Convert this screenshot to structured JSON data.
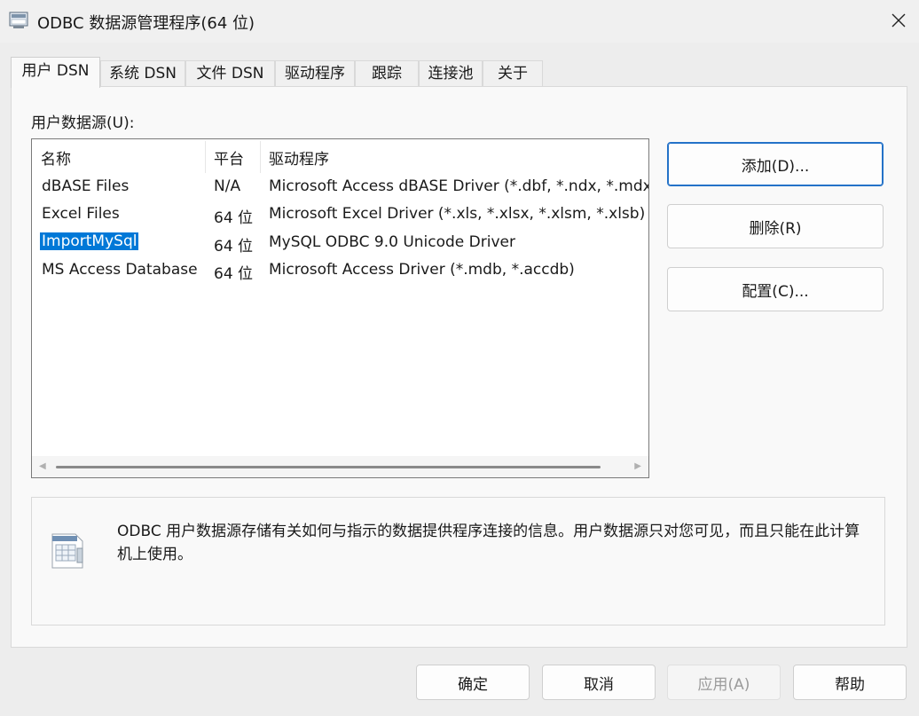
{
  "window": {
    "title": "ODBC 数据源管理程序(64 位)",
    "accent_color": "#e81123"
  },
  "tabs": [
    {
      "label": "用户 DSN",
      "active": true
    },
    {
      "label": "系统 DSN",
      "active": false
    },
    {
      "label": "文件 DSN",
      "active": false
    },
    {
      "label": "驱动程序",
      "active": false
    },
    {
      "label": "跟踪",
      "active": false
    },
    {
      "label": "连接池",
      "active": false
    },
    {
      "label": "关于",
      "active": false
    }
  ],
  "user_dsn": {
    "section_label": "用户数据源(U):",
    "columns": [
      "名称",
      "平台",
      "驱动程序"
    ],
    "rows": [
      {
        "name": "dBASE Files",
        "platform": "N/A",
        "driver": "Microsoft Access dBASE Driver (*.dbf, *.ndx, *.mdx)"
      },
      {
        "name": "Excel Files",
        "platform": "64 位",
        "driver": "Microsoft Excel Driver (*.xls, *.xlsx, *.xlsm, *.xlsb)"
      },
      {
        "name": "ImportMySql",
        "platform": "64 位",
        "driver": "MySQL ODBC 9.0 Unicode Driver"
      },
      {
        "name": "MS Access Database",
        "platform": "64 位",
        "driver": "Microsoft Access Driver (*.mdb, *.accdb)"
      }
    ],
    "selected_row": "ImportMySql",
    "selection_color": "#0078d7"
  },
  "side_buttons": {
    "add": "添加(D)...",
    "remove": "删除(R)",
    "configure": "配置(C)..."
  },
  "info": {
    "icon": "data-source-icon",
    "text": "ODBC 用户数据源存储有关如何与指示的数据提供程序连接的信息。用户数据源只对您可见，而且只能在此计算机上使用。"
  },
  "bottom_buttons": {
    "ok": "确定",
    "cancel": "取消",
    "apply": "应用(A)",
    "help": "帮助"
  }
}
